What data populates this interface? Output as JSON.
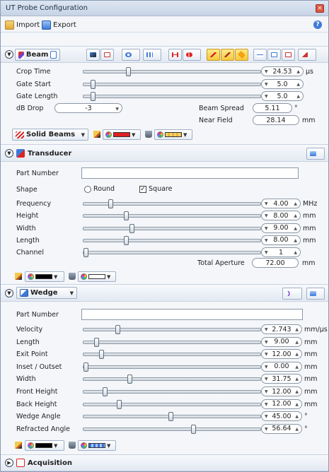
{
  "window": {
    "title": "UT Probe Configuration",
    "close_glyph": "×"
  },
  "menubar": {
    "import_label": "Import",
    "export_label": "Export",
    "help_glyph": "?"
  },
  "beam": {
    "header_label": "Beam",
    "crop_time": {
      "label": "Crop Time",
      "value": "24.53",
      "unit": "µs",
      "fraction": 0.25
    },
    "gate_start": {
      "label": "Gate Start",
      "value": "5.0",
      "fraction": 0.05
    },
    "gate_length": {
      "label": "Gate Length",
      "value": "5.0",
      "fraction": 0.05
    },
    "db_drop": {
      "label": "dB Drop",
      "value": "-3"
    },
    "beam_spread": {
      "label": "Beam Spread",
      "value": "5.11",
      "unit": "°"
    },
    "near_field": {
      "label": "Near Field",
      "value": "28.14",
      "unit": "mm"
    },
    "solid_beams_label": "Solid Beams"
  },
  "transducer": {
    "header_label": "Transducer",
    "part_number_label": "Part Number",
    "part_number_value": "",
    "shape_label": "Shape",
    "round_label": "Round",
    "square_label": "Square",
    "square_checked": "✓",
    "rows": [
      {
        "label": "Frequency",
        "value": "4.00",
        "unit": "MHz",
        "fraction": 0.15
      },
      {
        "label": "Height",
        "value": "8.00",
        "unit": "mm",
        "fraction": 0.24
      },
      {
        "label": "Width",
        "value": "9.00",
        "unit": "mm",
        "fraction": 0.27
      },
      {
        "label": "Length",
        "value": "8.00",
        "unit": "mm",
        "fraction": 0.24
      },
      {
        "label": "Channel",
        "value": "1",
        "unit": "",
        "fraction": 0.0
      }
    ],
    "total_aperture": {
      "label": "Total Aperture",
      "value": "72.00",
      "unit": "mm"
    }
  },
  "wedge": {
    "header_label": "Wedge",
    "part_number_label": "Part Number",
    "part_number_value": "",
    "rows": [
      {
        "label": "Velocity",
        "value": "2.743",
        "unit": "mm/µs",
        "fraction": 0.19
      },
      {
        "label": "Length",
        "value": "9.00",
        "unit": "mm",
        "fraction": 0.07
      },
      {
        "label": "Exit Point",
        "value": "12.00",
        "unit": "mm",
        "fraction": 0.1
      },
      {
        "label": "Inset / Outset",
        "value": "0.00",
        "unit": "mm",
        "fraction": 0.0
      },
      {
        "label": "Width",
        "value": "31.75",
        "unit": "mm",
        "fraction": 0.26
      },
      {
        "label": "Front Height",
        "value": "12.00",
        "unit": "mm",
        "fraction": 0.12
      },
      {
        "label": "Back Height",
        "value": "12.00",
        "unit": "mm",
        "fraction": 0.2
      },
      {
        "label": "Wedge Angle",
        "value": "45.00",
        "unit": "°",
        "fraction": 0.49
      },
      {
        "label": "Refracted Angle",
        "value": "56.64",
        "unit": "°",
        "fraction": 0.62
      }
    ]
  },
  "acquisition": {
    "header_label": "Acquisition"
  },
  "colors": {
    "accent": "#3d7ad8",
    "beam_red": "#e02020",
    "wedge_blue": "#3a6fe0",
    "highlight": "#f6c93b"
  }
}
